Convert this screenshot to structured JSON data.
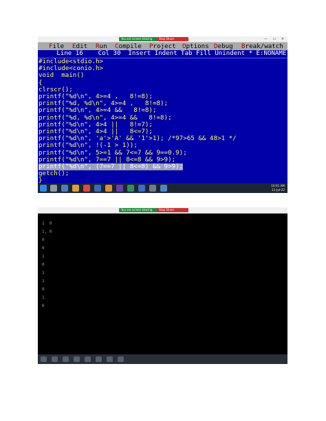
{
  "top_screen": {
    "share_bar": {
      "sharing_label": "You are screen sharing",
      "stop_label": "Stop Share",
      "window_buttons": "— ▭ ✕"
    },
    "menu": [
      {
        "label": "File",
        "hot": "F"
      },
      {
        "label": "Edit",
        "hot": "E"
      },
      {
        "label": "Run",
        "hot": "R"
      },
      {
        "label": "Compile",
        "hot": "C"
      },
      {
        "label": "Project",
        "hot": "P"
      },
      {
        "label": "Options",
        "hot": "O"
      },
      {
        "label": "Debug",
        "hot": "D"
      },
      {
        "label": "Break/watch",
        "hot": "B"
      }
    ],
    "status_line": "     Line 16    Col 30  Insert Indent Tab Fill Unindent * E:NONAME.C",
    "code_lines": [
      "#include<stdio.h>",
      "#include<conio.h>",
      "void  main()",
      "{",
      "clrscr();",
      "printf(\"%d\\n\", 4>=4 ,   8!=8);",
      "printf(\"%d, %d\\n\", 4>=4 ,   8!=8);",
      "printf(\"%d\\n\", 4>=4 &&   8!=8);",
      "printf(\"%d, %d\\n\", 4>=4 &&   8!=8);",
      "printf(\"%d\\n\", 4>4 ||   8!=7);",
      "printf(\"%d\\n\", 4>4 ||   8<=7);",
      "printf(\"%d\\n\", 'a'>'A' && '1'>1); /*97>65 && 48>1 */",
      "printf(\"%d\\n\", !(-1 > 1));",
      "printf(\"%d\\n\", 5>=1 && 7<=7 && 9==0.9);",
      "printf(\"%d\\n\", 7==7 || 8<=8 && 9>9);",
      "printf(\"%d\\n\", (7==7 || 8<=8) && 9>9);",
      "getch();",
      "}"
    ],
    "selected_line_index": 15,
    "taskbar": {
      "time": "10:01 AM",
      "date": "11-Jul-22"
    }
  },
  "bottom_screen": {
    "share_bar": {
      "sharing_label": "You are screen sharing",
      "stop_label": "Stop Share"
    },
    "output_lines": [
      "1  0",
      "",
      "1, 0",
      "",
      "0",
      "",
      "0",
      "",
      "1",
      "",
      "0",
      "",
      "1",
      "",
      "1",
      "",
      "0",
      "",
      "1",
      "",
      "0"
    ]
  },
  "colors": {
    "editor_bg": "#0000a8",
    "code_text": "#ffff55",
    "menu_bg": "#aaaaaa",
    "menu_hotkey": "#a80000",
    "selection_bg": "#9aa0b8",
    "share_green": "#1f8f3a",
    "share_red": "#d42b2b"
  }
}
